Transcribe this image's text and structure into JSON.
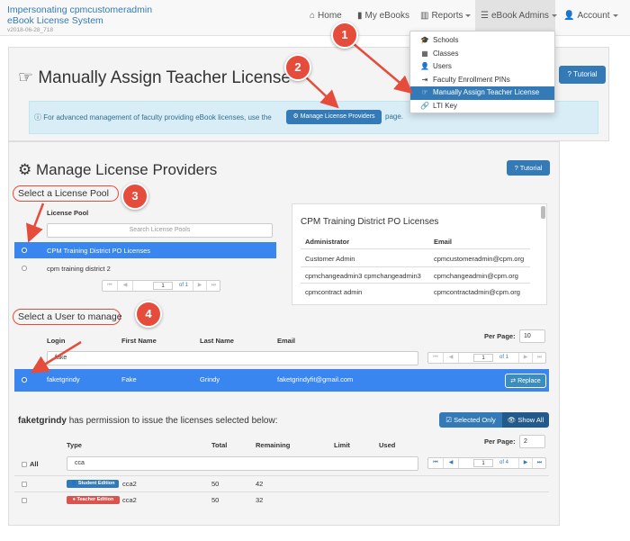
{
  "navbar": {
    "brand_line1": "Impersonating cpmcustomeradmin",
    "brand_line2": "eBook License System",
    "version": "v2018-06-28_718",
    "items": [
      {
        "label": "Home",
        "icon": "home-icon"
      },
      {
        "label": "My eBooks",
        "icon": "book-icon"
      },
      {
        "label": "Reports",
        "icon": "bar-chart-icon"
      },
      {
        "label": "eBook Admins",
        "icon": "list-icon"
      },
      {
        "label": "Account",
        "icon": "user-icon"
      }
    ]
  },
  "dropdown": {
    "items": [
      {
        "label": "Schools",
        "icon": "graduation-cap-icon"
      },
      {
        "label": "Classes",
        "icon": "calendar-icon"
      },
      {
        "label": "Users",
        "icon": "user-icon"
      },
      {
        "label": "Faculty Enrollment PINs",
        "icon": "sign-in-icon"
      },
      {
        "label": "Manually Assign Teacher License",
        "icon": "hand-point-right-icon",
        "selected": true
      },
      {
        "label": "LTI Key",
        "icon": "link-icon"
      }
    ]
  },
  "page": {
    "title": "Manually Assign Teacher License",
    "tutorial_label": "Tutorial",
    "info_text_before": "For advanced management of faculty providing eBook licenses, use the",
    "manage_providers_button": "Manage License Providers",
    "info_text_after": "page."
  },
  "providers": {
    "title": "Manage License Providers",
    "tutorial_label": "Tutorial",
    "pool_heading": "Select a License Pool",
    "pool_column": "License Pool",
    "pool_search_placeholder": "Search License Pools",
    "pools": [
      {
        "name": "CPM Training District PO Licenses",
        "selected": true
      },
      {
        "name": "cpm training district 2",
        "selected": false
      }
    ],
    "pool_pager": {
      "page": "1",
      "of": "of 1"
    },
    "admin_panel": {
      "title": "CPM Training District PO Licenses",
      "headers": [
        "Administrator",
        "Email"
      ],
      "rows": [
        [
          "Customer Admin",
          "cpmcustomeradmin@cpm.org"
        ],
        [
          "cpmchangeadmin3 cpmchangeadmin3",
          "cpmchangeadmin@cpm.org"
        ],
        [
          "cpmcontract admin",
          "cpmcontractadmin@cpm.org"
        ]
      ]
    },
    "user_heading": "Select a User to manage",
    "user_headers": [
      "Login",
      "First Name",
      "Last Name",
      "Email"
    ],
    "per_page_label": "Per Page:",
    "per_page_value": "10",
    "user_search_value": "fake",
    "user_pager": {
      "page": "1",
      "of": "of 1"
    },
    "users": [
      {
        "login": "faketgrindy",
        "first": "Fake",
        "last": "Grindy",
        "email": "faketgrindyfit@gmail.com",
        "action": "Replace"
      }
    ],
    "permission_user": "faketgrindy",
    "permission_text": "has permission to issue the licenses selected below:",
    "selected_only_label": "Selected Only",
    "show_all_label": "Show All",
    "license_headers": [
      "Type",
      "Total",
      "Remaining",
      "Limit",
      "Used"
    ],
    "license_per_page_label": "Per Page:",
    "license_per_page_value": "2",
    "all_label": "All",
    "license_search_value": "cca",
    "license_pager": {
      "page": "1",
      "of": "of 4"
    },
    "licenses": [
      {
        "edition": "Student Edition",
        "edition_color": "#337ab7",
        "name": "cca2",
        "total": "50",
        "remaining": "42"
      },
      {
        "edition": "Teacher Edition",
        "edition_color": "#d9534f",
        "name": "cca2",
        "total": "50",
        "remaining": "32"
      }
    ]
  },
  "callouts": [
    "1",
    "2",
    "3",
    "4"
  ],
  "colors": {
    "accent": "#337ab7",
    "selected_row": "#3a86f0",
    "callout": "#e64c3c",
    "info_bg": "#d9edf7"
  }
}
